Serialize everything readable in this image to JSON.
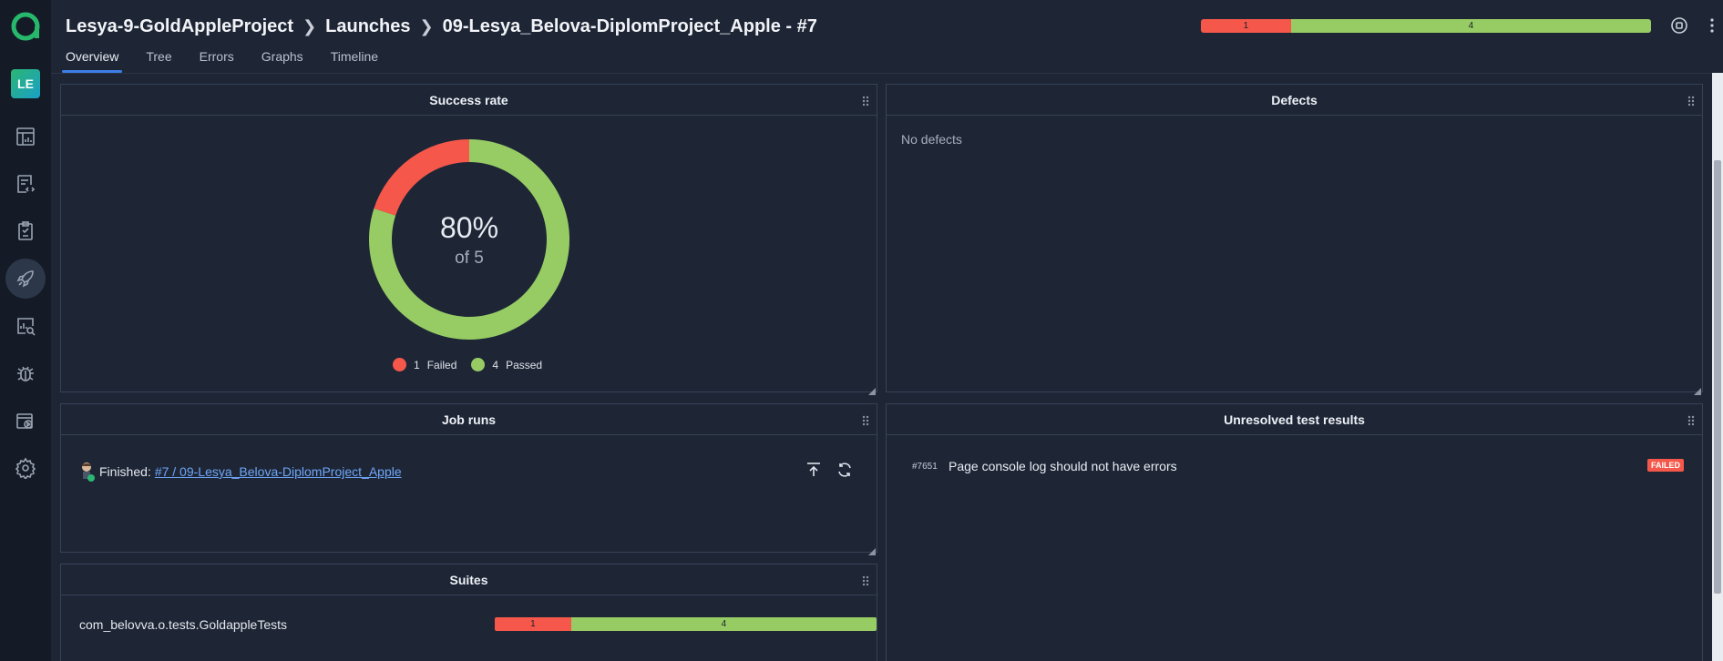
{
  "sidebar": {
    "avatar_initials": "LE",
    "items": [
      {
        "icon": "dashboards-icon",
        "active": false
      },
      {
        "icon": "test-cases-icon",
        "active": false
      },
      {
        "icon": "test-plans-icon",
        "active": false
      },
      {
        "icon": "launches-rocket-icon",
        "active": true
      },
      {
        "icon": "analytics-icon",
        "active": false
      },
      {
        "icon": "defects-bug-icon",
        "active": false
      },
      {
        "icon": "jobs-icon",
        "active": false
      },
      {
        "icon": "settings-gear-icon",
        "active": false
      }
    ]
  },
  "header": {
    "breadcrumbs": [
      "Lesya-9-GoldAppleProject",
      "Launches",
      "09-Lesya_Belova-DiplomProject_Apple - #7"
    ],
    "stats": {
      "failed": "1",
      "passed": "4",
      "failed_fraction": 0.2
    },
    "tabs": [
      "Overview",
      "Tree",
      "Errors",
      "Graphs",
      "Timeline"
    ],
    "active_tab": "Overview"
  },
  "widgets": {
    "success_rate": {
      "title": "Success rate",
      "percent": "80%",
      "of_total": "of 5",
      "legend": [
        {
          "count": "1",
          "label": "Failed",
          "color": "#f5584a"
        },
        {
          "count": "4",
          "label": "Passed",
          "color": "#97cc64"
        }
      ]
    },
    "defects": {
      "title": "Defects",
      "empty_text": "No defects"
    },
    "job_runs": {
      "title": "Job runs",
      "status_label": "Finished:",
      "link_text": "#7 / 09-Lesya_Belova-DiplomProject_Apple"
    },
    "unresolved": {
      "title": "Unresolved test results",
      "rows": [
        {
          "id": "#7651",
          "name": "Page console log should not have errors",
          "status": "FAILED"
        }
      ]
    },
    "suites": {
      "title": "Suites",
      "rows": [
        {
          "name": "com_belovva.o.tests.GoldappleTests",
          "failed": "1",
          "passed": "4",
          "failed_fraction": 0.2
        }
      ]
    }
  },
  "chart_data": {
    "type": "pie",
    "categories": [
      "Failed",
      "Passed"
    ],
    "values": [
      1,
      4
    ],
    "colors": [
      "#f5584a",
      "#97cc64"
    ],
    "title": "Success rate"
  }
}
